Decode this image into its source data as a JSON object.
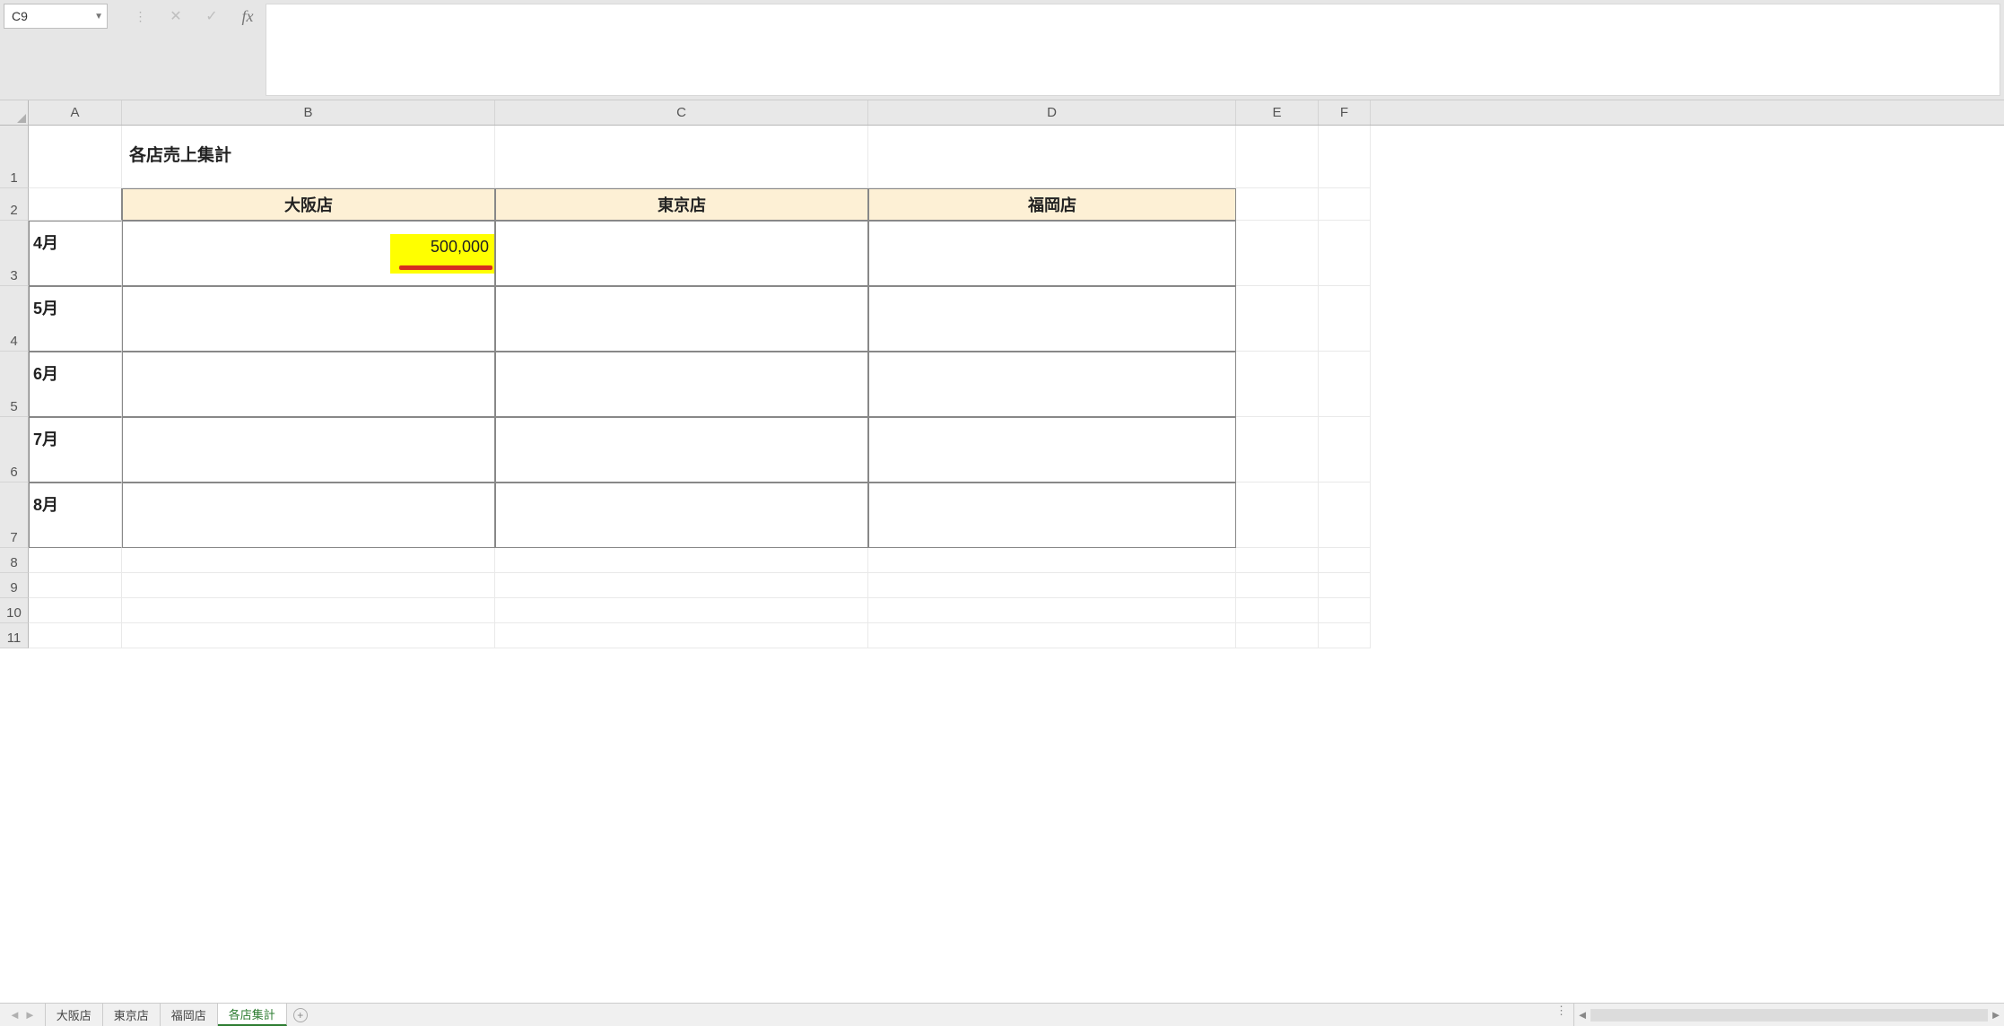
{
  "formula_bar": {
    "name_box": "C9",
    "fx_label": "fx",
    "formula_value": ""
  },
  "columns": [
    "A",
    "B",
    "C",
    "D",
    "E",
    "F"
  ],
  "row_numbers": [
    "1",
    "2",
    "3",
    "4",
    "5",
    "6",
    "7",
    "8",
    "9",
    "10",
    "11"
  ],
  "sheet": {
    "title": "各店売上集計",
    "column_headers": [
      "大阪店",
      "東京店",
      "福岡店"
    ],
    "row_labels": [
      "4月",
      "5月",
      "6月",
      "7月",
      "8月"
    ],
    "data": [
      [
        "500,000",
        "",
        ""
      ],
      [
        "",
        "",
        ""
      ],
      [
        "",
        "",
        ""
      ],
      [
        "",
        "",
        ""
      ],
      [
        "",
        "",
        ""
      ]
    ],
    "highlight": {
      "row": 0,
      "col": 0
    }
  },
  "tabs": {
    "items": [
      "大阪店",
      "東京店",
      "福岡店",
      "各店集計"
    ],
    "active_index": 3
  }
}
